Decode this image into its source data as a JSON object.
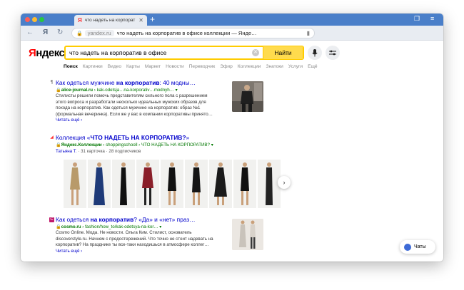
{
  "browser": {
    "tab_title": "что надеть на корпорат",
    "new_tab": "+",
    "address_domain": "yandex.ru",
    "address_title": "что надеть на корпоратив в офисе коллекции — Янде…"
  },
  "header": {
    "logo_first": "Я",
    "logo_rest": "ндекс",
    "search_value": "что надеть на корпоратив в офисе",
    "find_label": "Найти"
  },
  "nav_tabs": [
    "Поиск",
    "Картинки",
    "Видео",
    "Карты",
    "Маркет",
    "Новости",
    "Переводчик",
    "Эфир",
    "Коллекции",
    "Знатоки",
    "Услуги",
    "Ещё"
  ],
  "results": [
    {
      "title_pre": "Как одеться мужчине ",
      "title_bold": "на корпоратив",
      "title_post": ": 40 модны…",
      "url_domain": "alice-journal.ru",
      "url_path": " › kak-odetsja…na-korporativ…modnyh… ▾",
      "text": "Стилисты решили помочь представителям сильного пола с разрешением этого вопроса и разработали несколько идеальных мужских образов для похода на корпоратив. Как одеться мужчине на корпоратив: образ №1 (формальная вечеринка). Если же у вас в компании корпоративы принято…",
      "more": "Читать ещё ›"
    },
    {
      "title_pre": "Коллекция «",
      "title_bold": "ЧТО НАДЕТЬ НА КОРПОРАТИВ?",
      "title_post": "»",
      "url_domain": "Яндекс.Коллекции",
      "url_path": " › shoppingschooll › ЧТО НАДЕТЬ НА КОРПОРАТИВ? ▾",
      "author": "Татьяна Т.",
      "cards": "31 карточка",
      "subs": "28 подписчиков"
    },
    {
      "title_pre": "Как одеться ",
      "title_bold": "на корпоратив",
      "title_post": "? «Да» и «нет» праз…",
      "url_domain": "cosmo.ru",
      "url_path": " › fashion/how_to/kak-odetsya-na-kor… ▾",
      "text": "Cosmo Online. Мода. Не новости. Ольга Ким. Стилист, основатель discoverstyle.ru. Начнем с предостережений. Что точно не стоит надевать на корпоратив? На празднике ты все-таки находишься в атмосфере коллег…",
      "more": "Читать ещё ›"
    }
  ],
  "chat_label": "Чаты",
  "colors": {
    "tabbar": "#4a7fc9",
    "accent": "#ffdb4d",
    "link": "#0000cc",
    "url": "#007700"
  }
}
